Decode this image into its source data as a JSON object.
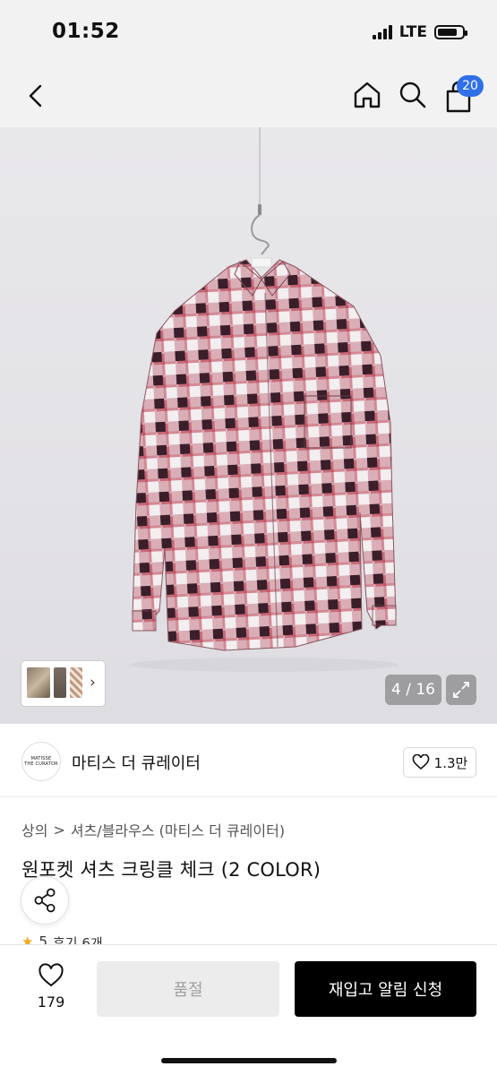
{
  "status_bar": {
    "time": "01:52",
    "network": "LTE"
  },
  "nav": {
    "cart_count": "20"
  },
  "gallery": {
    "counter": "4 / 16"
  },
  "brand": {
    "logo_line1": "MATISSE",
    "logo_line2": "THE CURATOR",
    "name": "마티스 더 큐레이터",
    "likes": "1.3만"
  },
  "breadcrumb": {
    "level1": "상의",
    "separator": ">",
    "level2": "셔츠/블라우스 (마티스 더 큐레이터)"
  },
  "product": {
    "title": "원포켓 셔츠 크링클 체크 (2 COLOR)",
    "rating": "5",
    "review_text": "후기 6개"
  },
  "bottom_bar": {
    "wish_count": "179",
    "soldout_label": "품절",
    "restock_label": "재입고 알림 신청"
  },
  "colors": {
    "accent_badge": "#2f6fe8",
    "primary_button": "#000000",
    "disabled_button": "#ececec",
    "star": "#f2a91b"
  }
}
